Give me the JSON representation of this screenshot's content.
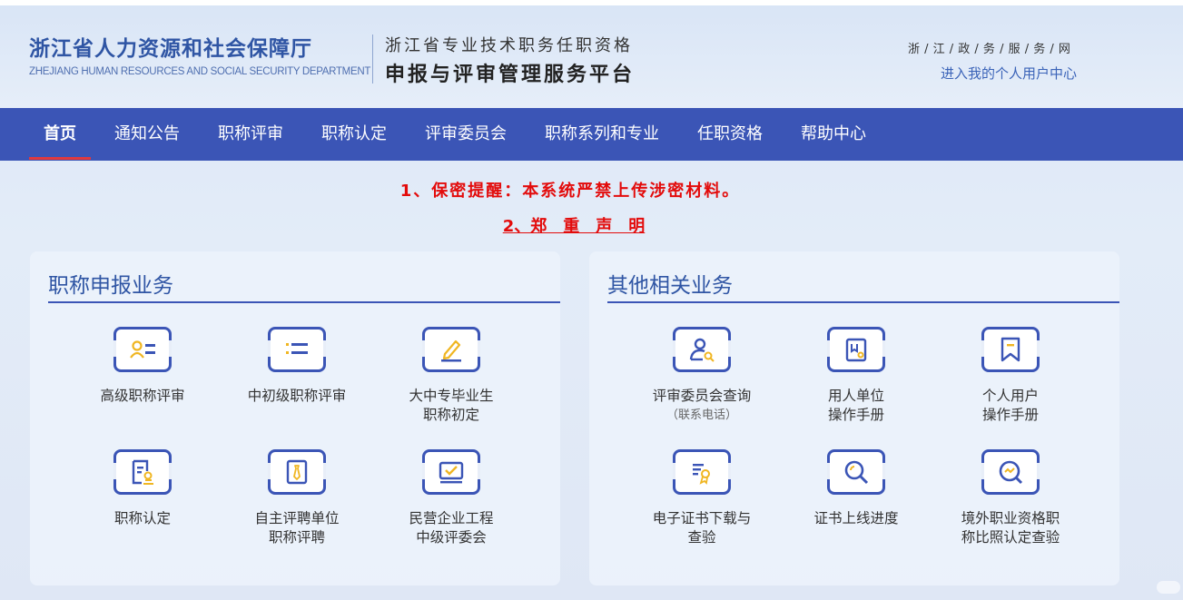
{
  "header": {
    "org_cn": "浙江省人力资源和社会保障厅",
    "org_en": "ZHEJIANG HUMAN RESOURCES AND SOCIAL SECURITY DEPARTMENT",
    "platform_line1": "浙江省专业技术职务任职资格",
    "platform_line2": "申报与评审管理服务平台",
    "gov_link": "浙 / 江 / 政 / 务 / 服 / 务 / 网",
    "user_center": "进入我的个人用户中心"
  },
  "nav": {
    "items": [
      "首页",
      "通知公告",
      "职称评审",
      "职称认定",
      "评审委员会",
      "职称系列和专业",
      "任职资格",
      "帮助中心"
    ],
    "active": "首页"
  },
  "notices": {
    "line1": "1、保密提醒：本系统严禁上传涉密材料。",
    "line2": "2、郑　重　声　明"
  },
  "left_panel": {
    "title": "职称申报业务",
    "tiles": [
      {
        "line1": "高级职称评审",
        "line2": "",
        "icon": "id-card-icon"
      },
      {
        "line1": "中初级职称评审",
        "line2": "",
        "icon": "list-icon"
      },
      {
        "line1": "大中专毕业生",
        "line2": "职称初定",
        "icon": "edit-icon"
      },
      {
        "line1": "职称认定",
        "line2": "",
        "icon": "certificate-stamp-icon"
      },
      {
        "line1": "自主评聘单位",
        "line2": "职称评聘",
        "icon": "tie-badge-icon"
      },
      {
        "line1": "民营企业工程",
        "line2": "中级评委会",
        "icon": "checkbox-icon"
      }
    ]
  },
  "right_panel": {
    "title": "其他相关业务",
    "tiles": [
      {
        "line1": "评审委员会查询",
        "line2": "（联系电话）",
        "icon": "user-search-icon"
      },
      {
        "line1": "用人单位",
        "line2": "操作手册",
        "icon": "manual-icon"
      },
      {
        "line1": "个人用户",
        "line2": "操作手册",
        "icon": "bookmark-icon"
      },
      {
        "line1": "电子证书下载与",
        "line2": "查验",
        "icon": "e-certificate-icon"
      },
      {
        "line1": "证书上线进度",
        "line2": "",
        "icon": "magnifier-icon"
      },
      {
        "line1": "境外职业资格职",
        "line2": "称比照认定查验",
        "icon": "compare-search-icon"
      }
    ]
  },
  "colors": {
    "primary": "#3b55b6",
    "accent": "#f0b622",
    "alert": "#e30b0b",
    "nav_active_underline": "#e0393e"
  }
}
